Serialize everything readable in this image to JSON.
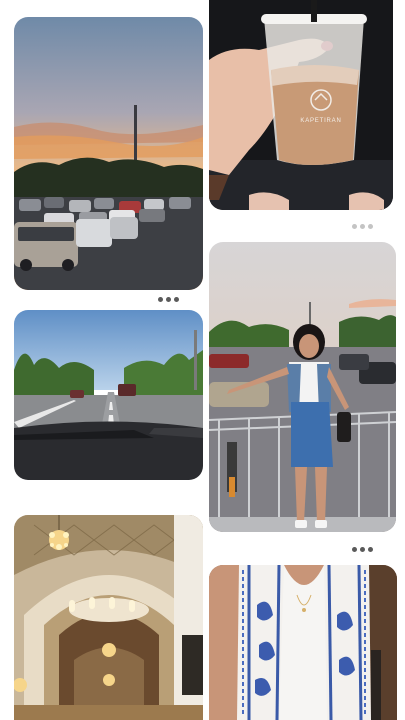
{
  "feed": {
    "pins": [
      {
        "subject": "sunset-parking-lot",
        "has_menu": true,
        "menu_tone": "dark"
      },
      {
        "subject": "iced-coffee-cup",
        "has_menu": true,
        "menu_tone": "light",
        "cup_logo_text": "KAPETIRAN"
      },
      {
        "subject": "car-dashboard-road",
        "has_menu": false
      },
      {
        "subject": "woman-posing-parking-lot",
        "has_menu": true,
        "menu_tone": "dark"
      },
      {
        "subject": "church-interior-ceiling",
        "has_menu": false
      },
      {
        "subject": "embroidered-vest-closeup",
        "has_menu": false
      }
    ]
  },
  "colors": {
    "menu_dark": "#5a5a5a",
    "menu_light": "#c4c4c4",
    "background": "#ffffff"
  }
}
